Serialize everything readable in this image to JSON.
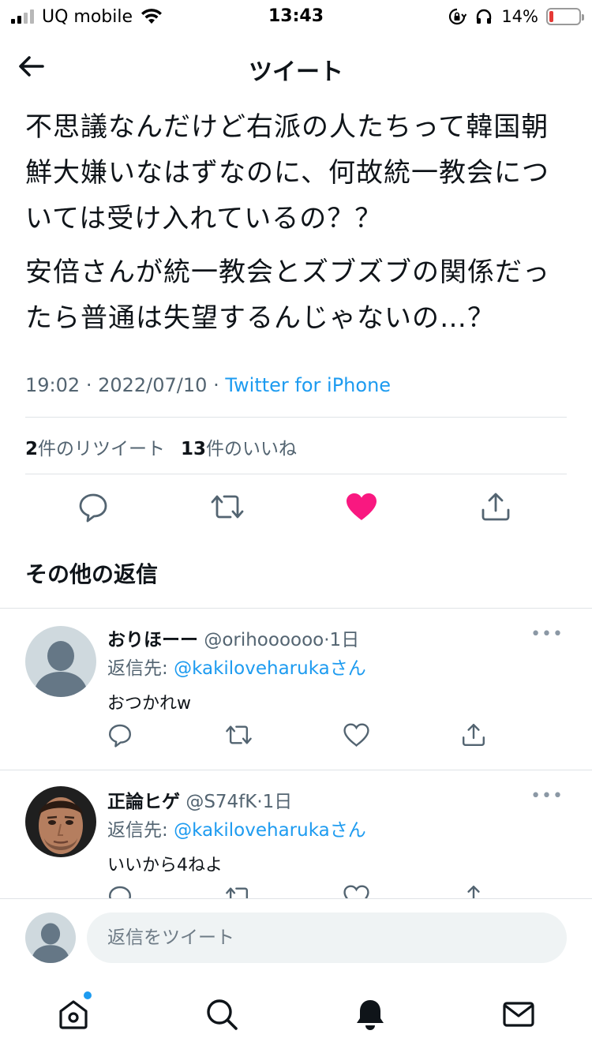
{
  "status_bar": {
    "carrier": "UQ mobile",
    "time": "13:43",
    "battery_percent": "14%",
    "battery_level": 0.14,
    "icons": [
      "signal-icon",
      "wifi-icon",
      "rotation-lock-icon",
      "headphones-icon",
      "battery-icon"
    ]
  },
  "header": {
    "title": "ツイート",
    "back_icon": "back-arrow-icon"
  },
  "tweet": {
    "paragraphs": [
      "不思議なんだけど右派の人たちって韓国朝鮮大嫌いなはずなのに、何故統一教会については受け入れているの？？",
      "安倍さんが統一教会とズブズブの関係だったら普通は失望するんじゃないの…？"
    ],
    "time": "19:02",
    "separator": "·",
    "date": "2022/07/10",
    "source": "Twitter for iPhone",
    "retweet_count": "2",
    "retweet_label": "件のリツイート",
    "like_count": "13",
    "like_label": "件のいいね",
    "liked": true
  },
  "section_title": "その他の返信",
  "replies": [
    {
      "name": "おりほーー",
      "handle": "@orihoooooo",
      "time": "·1日",
      "reply_prefix": "返信先: ",
      "reply_to": "@kakiloveharukaさん",
      "text": "おつかれw",
      "avatar": "default-avatar"
    },
    {
      "name": "正論ヒゲ",
      "handle": "@S74fK",
      "time": "·1日",
      "reply_prefix": "返信先: ",
      "reply_to": "@kakiloveharukaさん",
      "text": "いいから4ねよ",
      "avatar": "photo-avatar"
    }
  ],
  "more_label": "•••",
  "compose": {
    "placeholder": "返信をツイート"
  },
  "tabs": [
    "home-icon",
    "search-icon",
    "notifications-icon",
    "messages-icon"
  ],
  "colors": {
    "accent": "#1d9bf0",
    "like": "#f91880",
    "text": "#0f1419",
    "secondary": "#536471"
  }
}
